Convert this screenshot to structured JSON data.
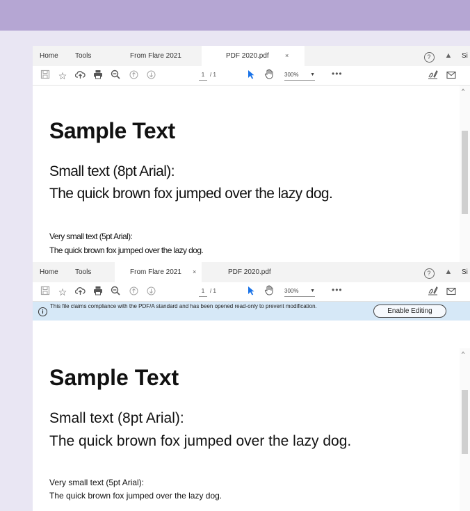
{
  "colors": {
    "banner": "#b5a6d3",
    "background": "#e9e6f3",
    "info_bar": "#d6e8f7",
    "accent": "#1a73e8"
  },
  "toolbar_icons": [
    "save-icon",
    "bookmark-star-icon",
    "upload-cloud-icon",
    "print-icon",
    "zoom-out-icon",
    "page-up-icon",
    "page-down-icon",
    "select-cursor-icon",
    "hand-tool-icon",
    "more-icon",
    "sign-icon",
    "mail-icon"
  ],
  "viewer1": {
    "tabs": {
      "home": "Home",
      "tools": "Tools",
      "tab1": "From Flare 2021",
      "tab2": "PDF 2020.pdf",
      "close_symbol": "×"
    },
    "sign_in": "Si",
    "page_current": "1",
    "page_total": "/ 1",
    "zoom": "300%",
    "more": "•••",
    "document": {
      "title": "Sample Text",
      "small_label": "Small text (8pt Arial):",
      "small_sentence": "The quick brown fox jumped over the lazy dog.",
      "very_small_label": "Very small text (5pt Arial):",
      "very_small_sentence": "The quick brown fox jumped over the lazy dog."
    }
  },
  "viewer2": {
    "tabs": {
      "home": "Home",
      "tools": "Tools",
      "tab1": "From Flare 2021",
      "tab2": "PDF 2020.pdf",
      "close_symbol": "×"
    },
    "sign_in": "Si",
    "page_current": "1",
    "page_total": "/ 1",
    "zoom": "300%",
    "more": "•••",
    "info_bar": {
      "message": "This file claims compliance with the PDF/A standard and has been opened read-only to prevent modification.",
      "button": "Enable Editing"
    },
    "document": {
      "title": "Sample Text",
      "small_label": "Small text (8pt Arial):",
      "small_sentence": "The quick brown fox jumped over the lazy dog.",
      "very_small_label": "Very small text (5pt Arial):",
      "very_small_sentence": "The quick brown fox jumped over the lazy dog."
    }
  }
}
